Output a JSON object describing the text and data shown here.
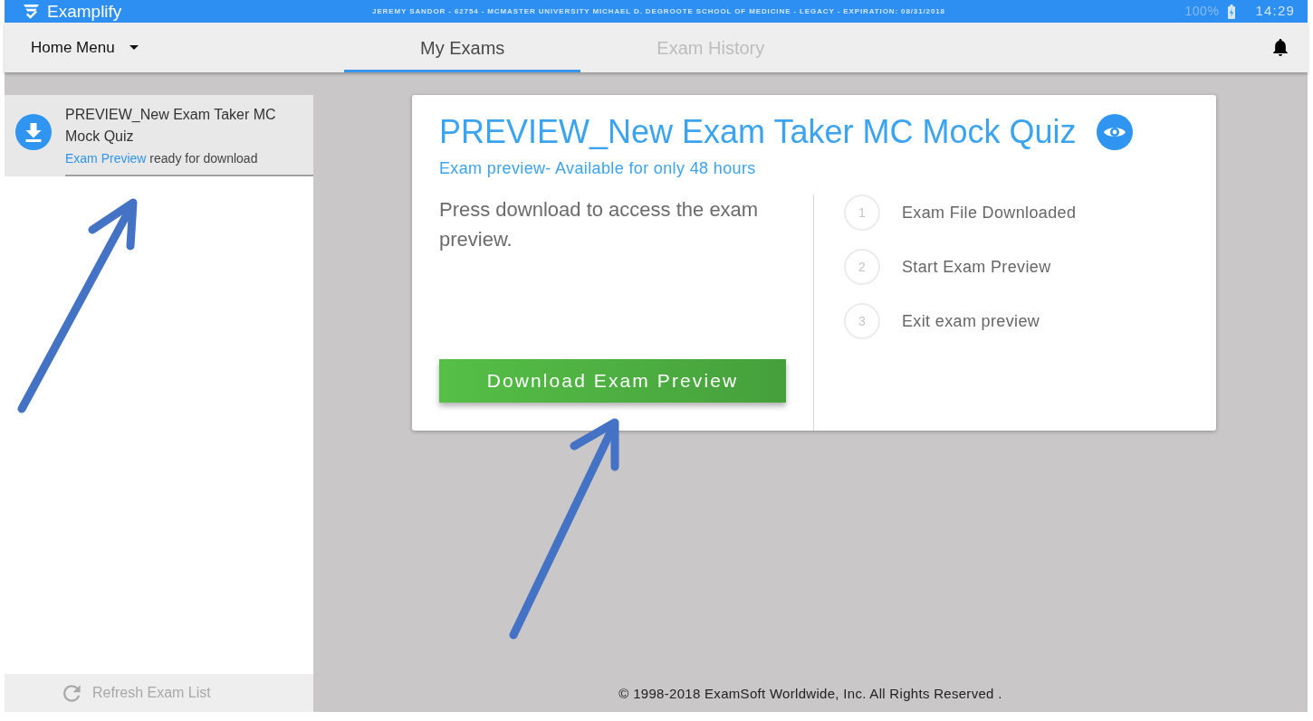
{
  "status_bar": {
    "app_name": "Examplify",
    "license": "JEREMY SANDOR - 62754 - MCMASTER UNIVERSITY MICHAEL D. DEGROOTE SCHOOL OF MEDICINE - LEGACY - EXPIRATION: 08/31/2018",
    "battery": "100%",
    "time": "14:29"
  },
  "nav": {
    "menu": "Home Menu",
    "tabs": [
      {
        "label": "My Exams",
        "selected": true
      },
      {
        "label": "Exam History",
        "selected": false
      }
    ]
  },
  "sidebar": {
    "items": [
      {
        "title": "PREVIEW_New Exam Taker MC Mock Quiz",
        "status_label": "Exam Preview",
        "status_text": "ready for download",
        "selected": true
      }
    ],
    "refresh_button": "Refresh Exam List"
  },
  "exam_card": {
    "title": "PREVIEW_New Exam Taker MC Mock Quiz",
    "subtitle": "Exam preview- Available for only 48 hours",
    "description": "Press download to access the exam preview.",
    "download_button": "Download Exam Preview",
    "steps": [
      {
        "number": "1",
        "label": "Exam File Downloaded"
      },
      {
        "number": "2",
        "label": "Start Exam Preview"
      },
      {
        "number": "3",
        "label": "Exit exam preview"
      }
    ]
  },
  "footer": "© 1998-2018 ExamSoft Worldwide, Inc. All Rights Reserved ."
}
